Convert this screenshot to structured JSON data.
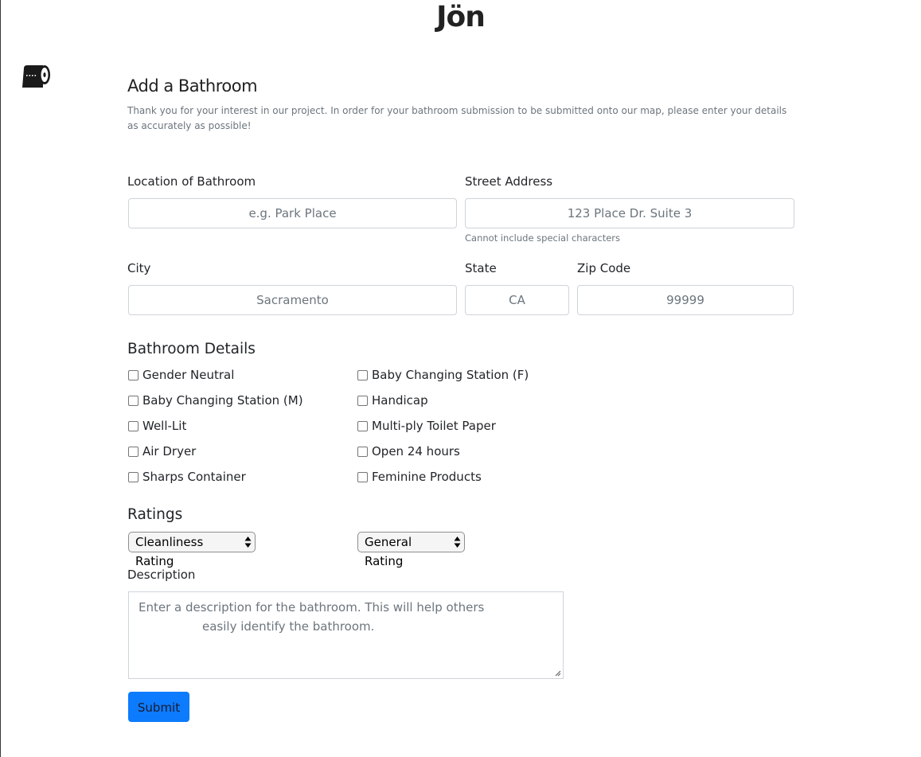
{
  "brand": "Jön",
  "icons": {
    "logo": "toilet-paper-icon"
  },
  "colors": {
    "accent": "#0d7bfd",
    "muted_text": "#6c757d",
    "border": "#ced4da"
  },
  "form": {
    "title": "Add a Bathroom",
    "intro": "Thank you for your interest in our project. In order for your bathroom submission to be submitted onto our map, please enter your details as accurately as possible!",
    "location": {
      "label": "Location of Bathroom",
      "placeholder": "e.g. Park Place",
      "value": ""
    },
    "street": {
      "label": "Street Address",
      "placeholder": "123 Place Dr. Suite 3",
      "value": "",
      "help": "Cannot include special characters"
    },
    "city": {
      "label": "City",
      "placeholder": "Sacramento",
      "value": ""
    },
    "state": {
      "label": "State",
      "placeholder": "CA",
      "value": ""
    },
    "zip": {
      "label": "Zip Code",
      "placeholder": "99999",
      "value": ""
    },
    "details": {
      "title": "Bathroom Details",
      "items": [
        {
          "label": "Gender Neutral",
          "checked": false
        },
        {
          "label": "Baby Changing Station (F)",
          "checked": false
        },
        {
          "label": "Baby Changing Station (M)",
          "checked": false
        },
        {
          "label": "Handicap",
          "checked": false
        },
        {
          "label": "Well-Lit",
          "checked": false
        },
        {
          "label": "Multi-ply Toilet Paper",
          "checked": false
        },
        {
          "label": "Air Dryer",
          "checked": false
        },
        {
          "label": "Open 24 hours",
          "checked": false
        },
        {
          "label": "Sharps Container",
          "checked": false
        },
        {
          "label": "Feminine Products",
          "checked": false
        }
      ]
    },
    "ratings": {
      "title": "Ratings",
      "cleanliness_selected": "Cleanliness Rating",
      "general_selected": "General Rating"
    },
    "description": {
      "label": "Description",
      "placeholder_line1": "Enter a description for the bathroom. This will help others",
      "placeholder_line2": "easily identify the bathroom."
    },
    "submit_label": "Submit"
  }
}
